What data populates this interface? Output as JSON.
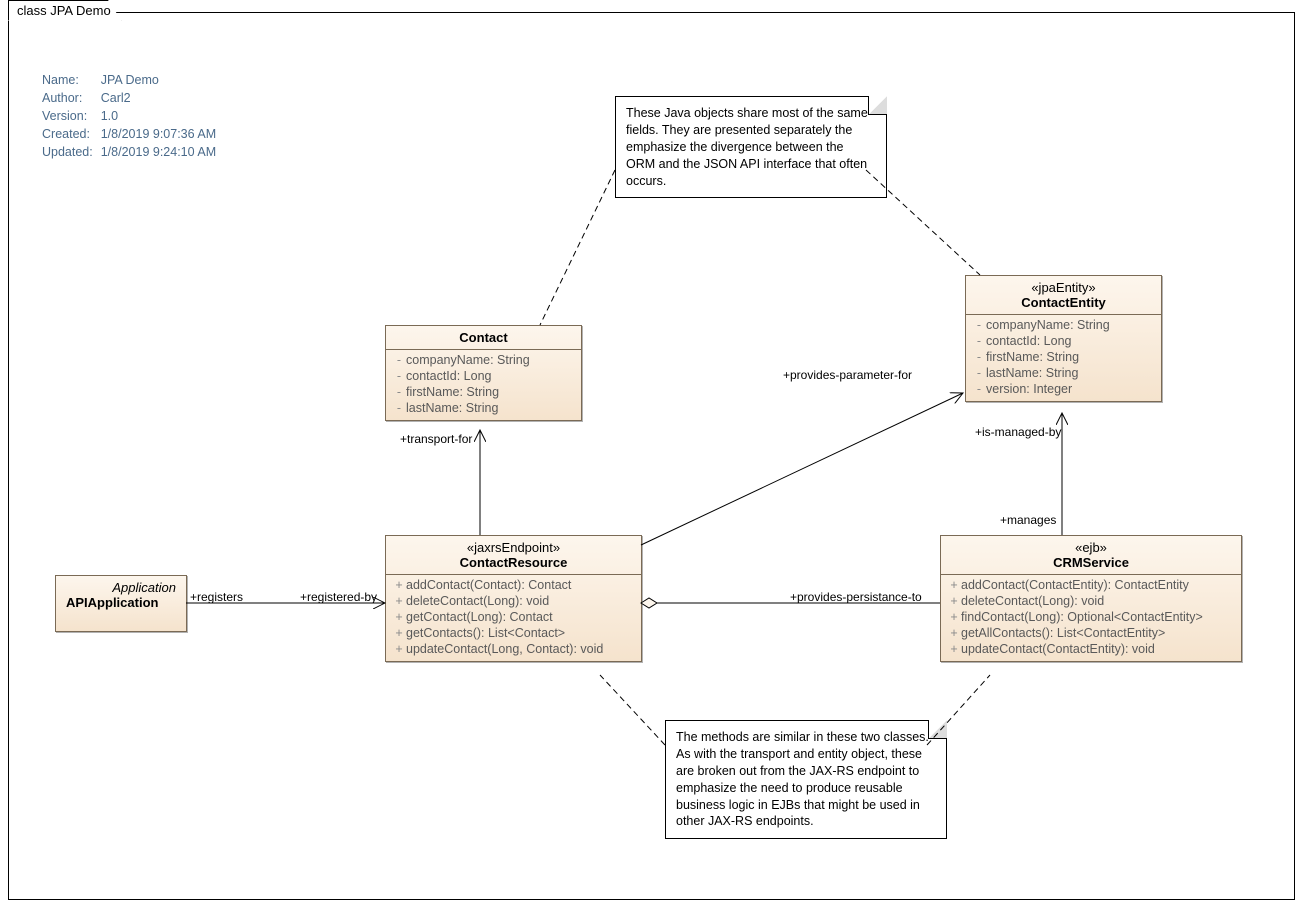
{
  "title": "class JPA Demo",
  "meta": {
    "name_k": "Name:",
    "name_v": "JPA Demo",
    "author_k": "Author:",
    "author_v": "Carl2",
    "version_k": "Version:",
    "version_v": "1.0",
    "created_k": "Created:",
    "created_v": "1/8/2019 9:07:36 AM",
    "updated_k": "Updated:",
    "updated_v": "1/8/2019 9:24:10 AM"
  },
  "note1": "These Java objects share most of the same fields.  They are presented separately the emphasize the divergence between the ORM and the JSON API interface that often occurs.",
  "note2": "The methods are similar in these two classes.  As with the transport and entity object, these are broken out from the JAX-RS endpoint to emphasize the need to produce reusable business logic in EJBs that might be used in other JAX-RS endpoints.",
  "api": {
    "stereo": "Application",
    "name": "APIApplication"
  },
  "contact": {
    "name": "Contact",
    "attrs": [
      "companyName: String",
      "contactId: Long",
      "firstName: String",
      "lastName: String"
    ]
  },
  "entity": {
    "stereo": "«jpaEntity»",
    "name": "ContactEntity",
    "attrs": [
      "companyName: String",
      "contactId: Long",
      "firstName: String",
      "lastName: String",
      "version: Integer"
    ]
  },
  "resource": {
    "stereo": "«jaxrsEndpoint»",
    "name": "ContactResource",
    "ops": [
      "addContact(Contact): Contact",
      "deleteContact(Long): void",
      "getContact(Long): Contact",
      "getContacts(): List<Contact>",
      "updateContact(Long, Contact): void"
    ]
  },
  "service": {
    "stereo": "«ejb»",
    "name": "CRMService",
    "ops": [
      "addContact(ContactEntity): ContactEntity",
      "deleteContact(Long): void",
      "findContact(Long): Optional<ContactEntity>",
      "getAllContacts(): List<ContactEntity>",
      "updateContact(ContactEntity): void"
    ]
  },
  "labels": {
    "registers": "+registers",
    "registered_by": "+registered-by",
    "transport_for": "+transport-for",
    "provides_param_for": "+provides-parameter-for",
    "is_managed_by": "+is-managed-by",
    "manages": "+manages",
    "provides_persist_to": "+provides-persistance-to"
  },
  "chart_data": {
    "type": "diagram",
    "title": "class JPA Demo",
    "classes": [
      {
        "name": "APIApplication",
        "stereotype": "Application",
        "attributes": [],
        "operations": []
      },
      {
        "name": "Contact",
        "stereotype": null,
        "attributes": [
          {
            "vis": "-",
            "sig": "companyName: String"
          },
          {
            "vis": "-",
            "sig": "contactId: Long"
          },
          {
            "vis": "-",
            "sig": "firstName: String"
          },
          {
            "vis": "-",
            "sig": "lastName: String"
          }
        ],
        "operations": []
      },
      {
        "name": "ContactEntity",
        "stereotype": "jpaEntity",
        "attributes": [
          {
            "vis": "-",
            "sig": "companyName: String"
          },
          {
            "vis": "-",
            "sig": "contactId: Long"
          },
          {
            "vis": "-",
            "sig": "firstName: String"
          },
          {
            "vis": "-",
            "sig": "lastName: String"
          },
          {
            "vis": "-",
            "sig": "version: Integer"
          }
        ],
        "operations": []
      },
      {
        "name": "ContactResource",
        "stereotype": "jaxrsEndpoint",
        "attributes": [],
        "operations": [
          {
            "vis": "+",
            "sig": "addContact(Contact): Contact"
          },
          {
            "vis": "+",
            "sig": "deleteContact(Long): void"
          },
          {
            "vis": "+",
            "sig": "getContact(Long): Contact"
          },
          {
            "vis": "+",
            "sig": "getContacts(): List<Contact>"
          },
          {
            "vis": "+",
            "sig": "updateContact(Long, Contact): void"
          }
        ]
      },
      {
        "name": "CRMService",
        "stereotype": "ejb",
        "attributes": [],
        "operations": [
          {
            "vis": "+",
            "sig": "addContact(ContactEntity): ContactEntity"
          },
          {
            "vis": "+",
            "sig": "deleteContact(Long): void"
          },
          {
            "vis": "+",
            "sig": "findContact(Long): Optional<ContactEntity>"
          },
          {
            "vis": "+",
            "sig": "getAllContacts(): List<ContactEntity>"
          },
          {
            "vis": "+",
            "sig": "updateContact(ContactEntity): void"
          }
        ]
      }
    ],
    "associations": [
      {
        "from": "APIApplication",
        "to": "ContactResource",
        "fromRole": "+registers",
        "toRole": "+registered-by",
        "kind": "association",
        "navigableTo": true
      },
      {
        "from": "ContactResource",
        "to": "Contact",
        "fromRole": null,
        "toRole": "+transport-for",
        "kind": "association",
        "navigableTo": true
      },
      {
        "from": "ContactResource",
        "to": "ContactEntity",
        "fromRole": null,
        "toRole": "+provides-parameter-for",
        "kind": "association",
        "navigableTo": true
      },
      {
        "from": "ContactResource",
        "to": "CRMService",
        "fromRole": null,
        "toRole": "+provides-persistance-to",
        "kind": "aggregation",
        "diamondAt": "ContactResource"
      },
      {
        "from": "CRMService",
        "to": "ContactEntity",
        "fromRole": "+manages",
        "toRole": "+is-managed-by",
        "kind": "association",
        "navigableTo": true
      }
    ],
    "notes": [
      {
        "text": "These Java objects share most of the same fields.  They are presented separately the emphasize the divergence between the ORM and the JSON API interface that often occurs.",
        "links": [
          "Contact",
          "ContactEntity"
        ]
      },
      {
        "text": "The methods are similar in these two classes.  As with the transport and entity object, these are broken out from the JAX-RS endpoint to emphasize the need to produce reusable business logic in EJBs that might be used in other JAX-RS endpoints.",
        "links": [
          "ContactResource",
          "CRMService"
        ]
      }
    ],
    "metadata": {
      "Name": "JPA Demo",
      "Author": "Carl2",
      "Version": "1.0",
      "Created": "1/8/2019 9:07:36 AM",
      "Updated": "1/8/2019 9:24:10 AM"
    }
  }
}
